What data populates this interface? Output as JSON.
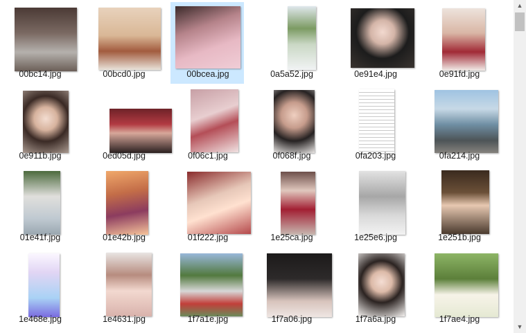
{
  "files": [
    {
      "name": "00bc14.jpg",
      "look": "ph-street",
      "selected": false
    },
    {
      "name": "00bcd0.jpg",
      "look": "ph-kid",
      "selected": false
    },
    {
      "name": "00bcea.jpg",
      "look": "ph-pink",
      "selected": true
    },
    {
      "name": "0a5a52.jpg",
      "look": "ph-phone",
      "selected": false
    },
    {
      "name": "0e91e4.jpg",
      "look": "ph-girl1",
      "selected": false
    },
    {
      "name": "0e91fd.jpg",
      "look": "ph-kids2",
      "selected": false
    },
    {
      "name": "0e911b.jpg",
      "look": "ph-hair",
      "selected": false
    },
    {
      "name": "0ed05d.jpg",
      "look": "ph-car",
      "selected": false
    },
    {
      "name": "0f06c1.jpg",
      "look": "ph-draw",
      "selected": false
    },
    {
      "name": "0f068f.jpg",
      "look": "ph-portrait",
      "selected": false
    },
    {
      "name": "0fa203.jpg",
      "look": "ph-doc",
      "selected": false
    },
    {
      "name": "0fa214.jpg",
      "look": "ph-sea",
      "selected": false
    },
    {
      "name": "01e41f.jpg",
      "look": "ph-white",
      "selected": false
    },
    {
      "name": "01e42b.jpg",
      "look": "ph-anime",
      "selected": false
    },
    {
      "name": "01f222.jpg",
      "look": "ph-selfie",
      "selected": false
    },
    {
      "name": "1e25ca.jpg",
      "look": "ph-dress",
      "selected": false
    },
    {
      "name": "1e25e6.jpg",
      "look": "ph-sketch",
      "selected": false
    },
    {
      "name": "1e251b.jpg",
      "look": "ph-cafe",
      "selected": false
    },
    {
      "name": "1e468e.jpg",
      "look": "ph-list",
      "selected": false
    },
    {
      "name": "1e4631.jpg",
      "look": "ph-hat",
      "selected": false
    },
    {
      "name": "1f7a1e.jpg",
      "look": "ph-park",
      "selected": false
    },
    {
      "name": "1f7a06.jpg",
      "look": "ph-legs",
      "selected": false
    },
    {
      "name": "1f7a6a.jpg",
      "look": "ph-pose",
      "selected": false
    },
    {
      "name": "1f7ae4.jpg",
      "look": "ph-flowers",
      "selected": false
    }
  ],
  "scrollbar": {
    "up_icon": "scroll-up-arrow-icon",
    "down_icon": "scroll-down-arrow-icon",
    "up_glyph": "▲",
    "down_glyph": "▼"
  },
  "colors": {
    "selection": "#cce8ff",
    "background": "#ffffff",
    "scrollbar_track": "#f0f0f0",
    "scrollbar_thumb": "#c1c1c1"
  }
}
